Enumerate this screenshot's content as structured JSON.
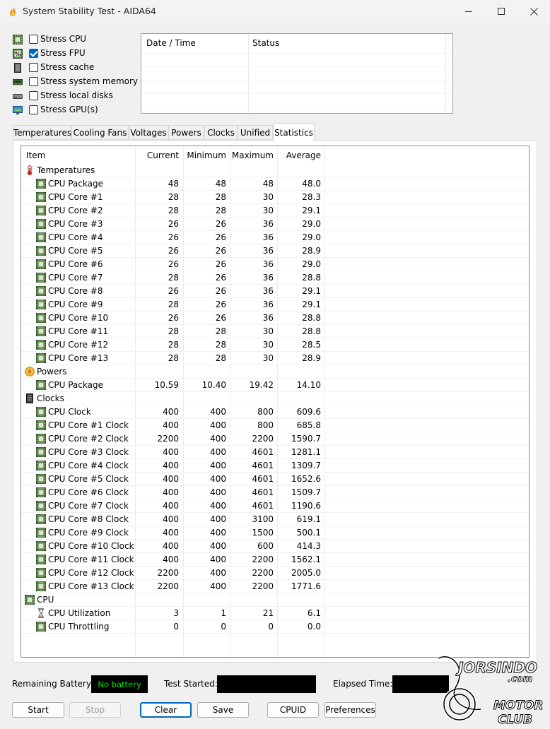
{
  "window": {
    "title": "System Stability Test - AIDA64"
  },
  "options": [
    {
      "label": "Stress CPU",
      "checked": false,
      "icon": "cpu-chip-icon"
    },
    {
      "label": "Stress FPU",
      "checked": true,
      "icon": "percent-icon"
    },
    {
      "label": "Stress cache",
      "checked": false,
      "icon": "cache-icon"
    },
    {
      "label": "Stress system memory",
      "checked": false,
      "icon": "memory-icon"
    },
    {
      "label": "Stress local disks",
      "checked": false,
      "icon": "disk-icon"
    },
    {
      "label": "Stress GPU(s)",
      "checked": false,
      "icon": "monitor-icon"
    }
  ],
  "log": {
    "col_datetime": "Date / Time",
    "col_status": "Status"
  },
  "tabs": [
    "Temperatures",
    "Cooling Fans",
    "Voltages",
    "Powers",
    "Clocks",
    "Unified",
    "Statistics"
  ],
  "active_tab": "Statistics",
  "table": {
    "headers": {
      "item": "Item",
      "current": "Current",
      "minimum": "Minimum",
      "maximum": "Maximum",
      "average": "Average"
    },
    "rows": [
      {
        "group": true,
        "name": "Temperatures",
        "icon": "thermometer-icon"
      },
      {
        "name": "CPU Package",
        "icon": "cpu-chip-icon",
        "current": "48",
        "minimum": "48",
        "maximum": "48",
        "average": "48.0"
      },
      {
        "name": "CPU Core #1",
        "icon": "cpu-chip-icon",
        "current": "28",
        "minimum": "28",
        "maximum": "30",
        "average": "28.3"
      },
      {
        "name": "CPU Core #2",
        "icon": "cpu-chip-icon",
        "current": "28",
        "minimum": "28",
        "maximum": "30",
        "average": "29.1"
      },
      {
        "name": "CPU Core #3",
        "icon": "cpu-chip-icon",
        "current": "26",
        "minimum": "26",
        "maximum": "36",
        "average": "29.0"
      },
      {
        "name": "CPU Core #4",
        "icon": "cpu-chip-icon",
        "current": "26",
        "minimum": "26",
        "maximum": "36",
        "average": "29.0"
      },
      {
        "name": "CPU Core #5",
        "icon": "cpu-chip-icon",
        "current": "26",
        "minimum": "26",
        "maximum": "36",
        "average": "28.9"
      },
      {
        "name": "CPU Core #6",
        "icon": "cpu-chip-icon",
        "current": "26",
        "minimum": "26",
        "maximum": "36",
        "average": "29.0"
      },
      {
        "name": "CPU Core #7",
        "icon": "cpu-chip-icon",
        "current": "28",
        "minimum": "26",
        "maximum": "36",
        "average": "28.8"
      },
      {
        "name": "CPU Core #8",
        "icon": "cpu-chip-icon",
        "current": "26",
        "minimum": "26",
        "maximum": "36",
        "average": "29.1"
      },
      {
        "name": "CPU Core #9",
        "icon": "cpu-chip-icon",
        "current": "28",
        "minimum": "26",
        "maximum": "36",
        "average": "29.1"
      },
      {
        "name": "CPU Core #10",
        "icon": "cpu-chip-icon",
        "current": "26",
        "minimum": "26",
        "maximum": "36",
        "average": "28.8"
      },
      {
        "name": "CPU Core #11",
        "icon": "cpu-chip-icon",
        "current": "28",
        "minimum": "28",
        "maximum": "30",
        "average": "28.8"
      },
      {
        "name": "CPU Core #12",
        "icon": "cpu-chip-icon",
        "current": "28",
        "minimum": "28",
        "maximum": "30",
        "average": "28.5"
      },
      {
        "name": "CPU Core #13",
        "icon": "cpu-chip-icon",
        "current": "28",
        "minimum": "28",
        "maximum": "30",
        "average": "28.9"
      },
      {
        "group": true,
        "name": "Powers",
        "icon": "power-icon"
      },
      {
        "name": "CPU Package",
        "icon": "cpu-chip-icon",
        "current": "10.59",
        "minimum": "10.40",
        "maximum": "19.42",
        "average": "14.10"
      },
      {
        "group": true,
        "name": "Clocks",
        "icon": "clock-chip-icon"
      },
      {
        "name": "CPU Clock",
        "icon": "cpu-chip-icon",
        "current": "400",
        "minimum": "400",
        "maximum": "800",
        "average": "609.6"
      },
      {
        "name": "CPU Core #1 Clock",
        "icon": "cpu-chip-icon",
        "current": "400",
        "minimum": "400",
        "maximum": "800",
        "average": "685.8"
      },
      {
        "name": "CPU Core #2 Clock",
        "icon": "cpu-chip-icon",
        "current": "2200",
        "minimum": "400",
        "maximum": "2200",
        "average": "1590.7"
      },
      {
        "name": "CPU Core #3 Clock",
        "icon": "cpu-chip-icon",
        "current": "400",
        "minimum": "400",
        "maximum": "4601",
        "average": "1281.1"
      },
      {
        "name": "CPU Core #4 Clock",
        "icon": "cpu-chip-icon",
        "current": "400",
        "minimum": "400",
        "maximum": "4601",
        "average": "1309.7"
      },
      {
        "name": "CPU Core #5 Clock",
        "icon": "cpu-chip-icon",
        "current": "400",
        "minimum": "400",
        "maximum": "4601",
        "average": "1652.6"
      },
      {
        "name": "CPU Core #6 Clock",
        "icon": "cpu-chip-icon",
        "current": "400",
        "minimum": "400",
        "maximum": "4601",
        "average": "1509.7"
      },
      {
        "name": "CPU Core #7 Clock",
        "icon": "cpu-chip-icon",
        "current": "400",
        "minimum": "400",
        "maximum": "4601",
        "average": "1190.6"
      },
      {
        "name": "CPU Core #8 Clock",
        "icon": "cpu-chip-icon",
        "current": "400",
        "minimum": "400",
        "maximum": "3100",
        "average": "619.1"
      },
      {
        "name": "CPU Core #9 Clock",
        "icon": "cpu-chip-icon",
        "current": "400",
        "minimum": "400",
        "maximum": "1500",
        "average": "500.1"
      },
      {
        "name": "CPU Core #10 Clock",
        "icon": "cpu-chip-icon",
        "current": "400",
        "minimum": "400",
        "maximum": "600",
        "average": "414.3"
      },
      {
        "name": "CPU Core #11 Clock",
        "icon": "cpu-chip-icon",
        "current": "400",
        "minimum": "400",
        "maximum": "2200",
        "average": "1562.1"
      },
      {
        "name": "CPU Core #12 Clock",
        "icon": "cpu-chip-icon",
        "current": "2200",
        "minimum": "400",
        "maximum": "2200",
        "average": "2005.0"
      },
      {
        "name": "CPU Core #13 Clock",
        "icon": "cpu-chip-icon",
        "current": "2200",
        "minimum": "400",
        "maximum": "2200",
        "average": "1771.6"
      },
      {
        "group": true,
        "name": "CPU",
        "icon": "cpu-chip-icon"
      },
      {
        "name": "CPU Utilization",
        "icon": "hourglass-icon",
        "current": "3",
        "minimum": "1",
        "maximum": "21",
        "average": "6.1"
      },
      {
        "name": "CPU Throttling",
        "icon": "cpu-chip-icon",
        "current": "0",
        "minimum": "0",
        "maximum": "0",
        "average": "0.0"
      }
    ]
  },
  "status": {
    "battery_label": "Remaining Battery:",
    "battery_value": "No battery",
    "started_label": "Test Started:",
    "started_value": "",
    "elapsed_label": "Elapsed Time:",
    "elapsed_value": ""
  },
  "buttons": {
    "start": "Start",
    "stop": "Stop",
    "clear": "Clear",
    "save": "Save",
    "cpuid": "CPUID",
    "preferences": "Preferences"
  },
  "watermark": {
    "line1": "JORSINDO",
    "line2": ".com",
    "line3": "MOTOR",
    "line4": "CLUB"
  },
  "colors": {
    "accent": "#0067c0",
    "battery_text": "#00e000",
    "watermark": "#ffffff"
  }
}
